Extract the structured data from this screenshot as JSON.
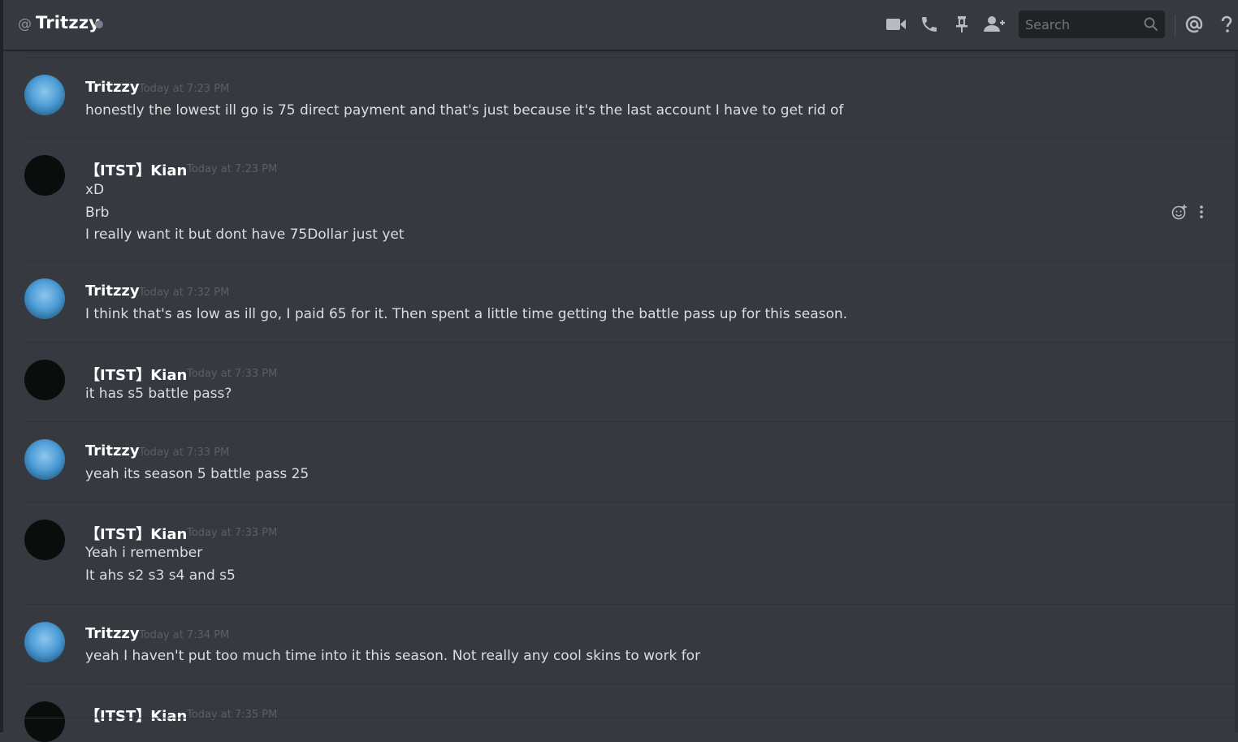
{
  "header": {
    "at_symbol": "@",
    "title": "Tritzzy",
    "search_placeholder": "Search",
    "icons": [
      "video-call-icon",
      "voice-call-icon",
      "pin-icon",
      "add-friend-icon",
      "search-icon",
      "mentions-icon",
      "help-icon"
    ]
  },
  "messages": [
    {
      "user": "Tritzzy",
      "timestamp": "Today at 7:23 PM",
      "lines": [
        "honestly the lowest ill go is 75 direct payment and that's just because it's the last account I have to get rid of"
      ]
    },
    {
      "user": "【ITST】Kian",
      "timestamp": "Today at 7:23 PM",
      "lines": [
        "xD",
        "Brb",
        "I really want it but dont have 75Dollar just yet"
      ]
    },
    {
      "user": "Tritzzy",
      "timestamp": "Today at 7:32 PM",
      "lines": [
        "I think that's as low as ill go, I paid 65 for it. Then spent a little time getting the battle pass up for this season."
      ]
    },
    {
      "user": "【ITST】Kian",
      "timestamp": "Today at 7:33 PM",
      "lines": [
        "it has s5 battle pass?"
      ]
    },
    {
      "user": "Tritzzy",
      "timestamp": "Today at 7:33 PM",
      "lines": [
        "yeah its season 5 battle pass 25"
      ]
    },
    {
      "user": "【ITST】Kian",
      "timestamp": "Today at 7:33 PM",
      "lines": [
        "Yeah i remember",
        "It ahs s2 s3 s4 and s5"
      ]
    },
    {
      "user": "Tritzzy",
      "timestamp": "Today at 7:34 PM",
      "lines": [
        "yeah I haven't put too much time into it this season. Not really any cool skins to work for"
      ]
    },
    {
      "user": "【ITST】Kian",
      "timestamp": "Today at 7:35 PM",
      "lines": []
    }
  ],
  "hover_actions": [
    "add-reaction-icon",
    "more-options-icon"
  ],
  "colors": {
    "background": "#36393f",
    "text": "#dcddde",
    "username": "#ffffff",
    "timestamp": "#5c5f65",
    "search_bg": "#202225"
  }
}
